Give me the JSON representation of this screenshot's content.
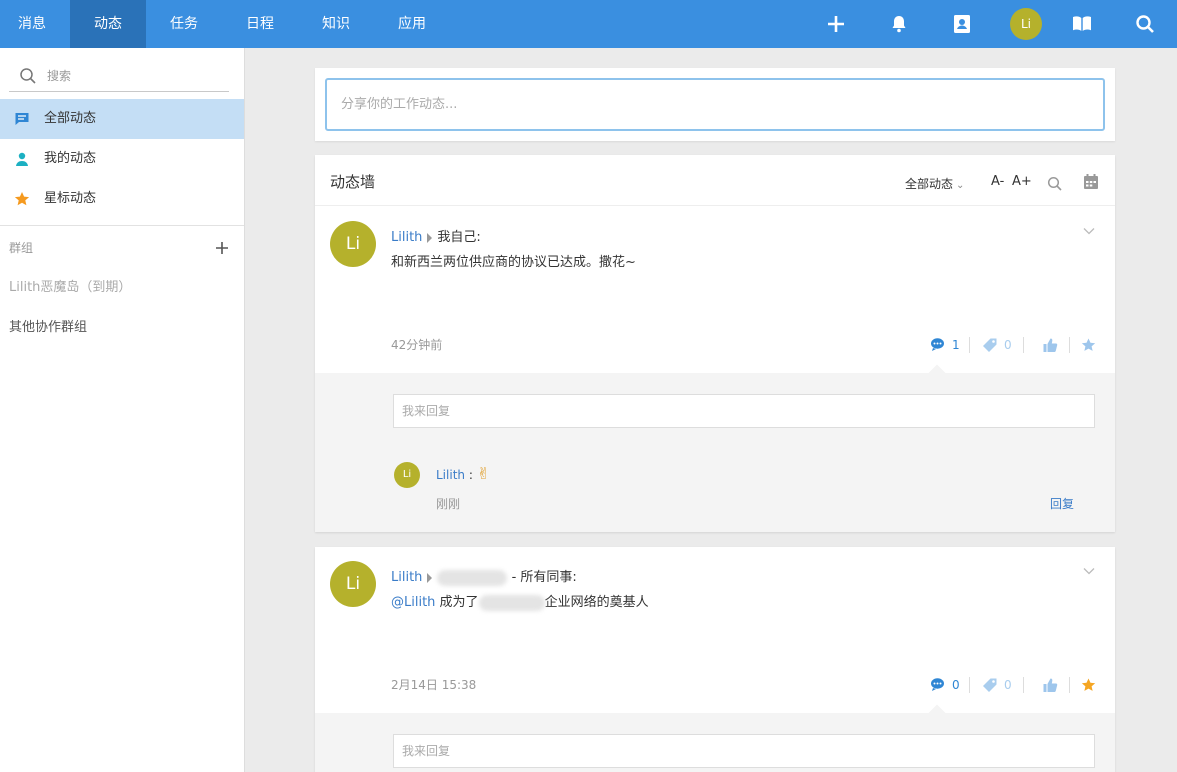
{
  "nav": {
    "tabs": [
      {
        "label": "消息"
      },
      {
        "label": "动态"
      },
      {
        "label": "任务"
      },
      {
        "label": "日程"
      },
      {
        "label": "知识"
      },
      {
        "label": "应用"
      }
    ],
    "avatar_initials": "Li",
    "accent": "#3a8fe0"
  },
  "sidebar": {
    "search_placeholder": "搜索",
    "items": [
      {
        "label": "全部动态",
        "icon": "chat-bubble-icon"
      },
      {
        "label": "我的动态",
        "icon": "person-icon"
      },
      {
        "label": "星标动态",
        "icon": "star-icon"
      }
    ],
    "groups_title": "群组",
    "groups": [
      {
        "label": "Lilith恶魔岛（到期）"
      },
      {
        "label": "其他协作群组"
      }
    ]
  },
  "composer": {
    "placeholder": "分享你的工作动态..."
  },
  "wall": {
    "title": "动态墙",
    "filter_label": "全部动态",
    "font_decrease": "A-",
    "font_increase": "A+"
  },
  "posts": [
    {
      "avatar_initials": "Li",
      "author": "Lilith",
      "target": "我自己:",
      "content": "和新西兰两位供应商的协议已达成。撒花~",
      "time": "42分钟前",
      "comments_count": "1",
      "tags_count": "0",
      "reply_placeholder": "我来回复",
      "comments": [
        {
          "avatar_initials": "Li",
          "author": "Lilith",
          "separator": ":",
          "emoji": "✌",
          "time": "刚刚",
          "reply_label": "回复"
        }
      ]
    },
    {
      "avatar_initials": "Li",
      "author": "Lilith",
      "target": "- 所有同事:",
      "mention": "@Lilith",
      "content_before": " 成为了",
      "content_after": "企业网络的奠基人",
      "time": "2月14日 15:38",
      "comments_count": "0",
      "tags_count": "0",
      "reply_placeholder": "我来回复"
    }
  ]
}
